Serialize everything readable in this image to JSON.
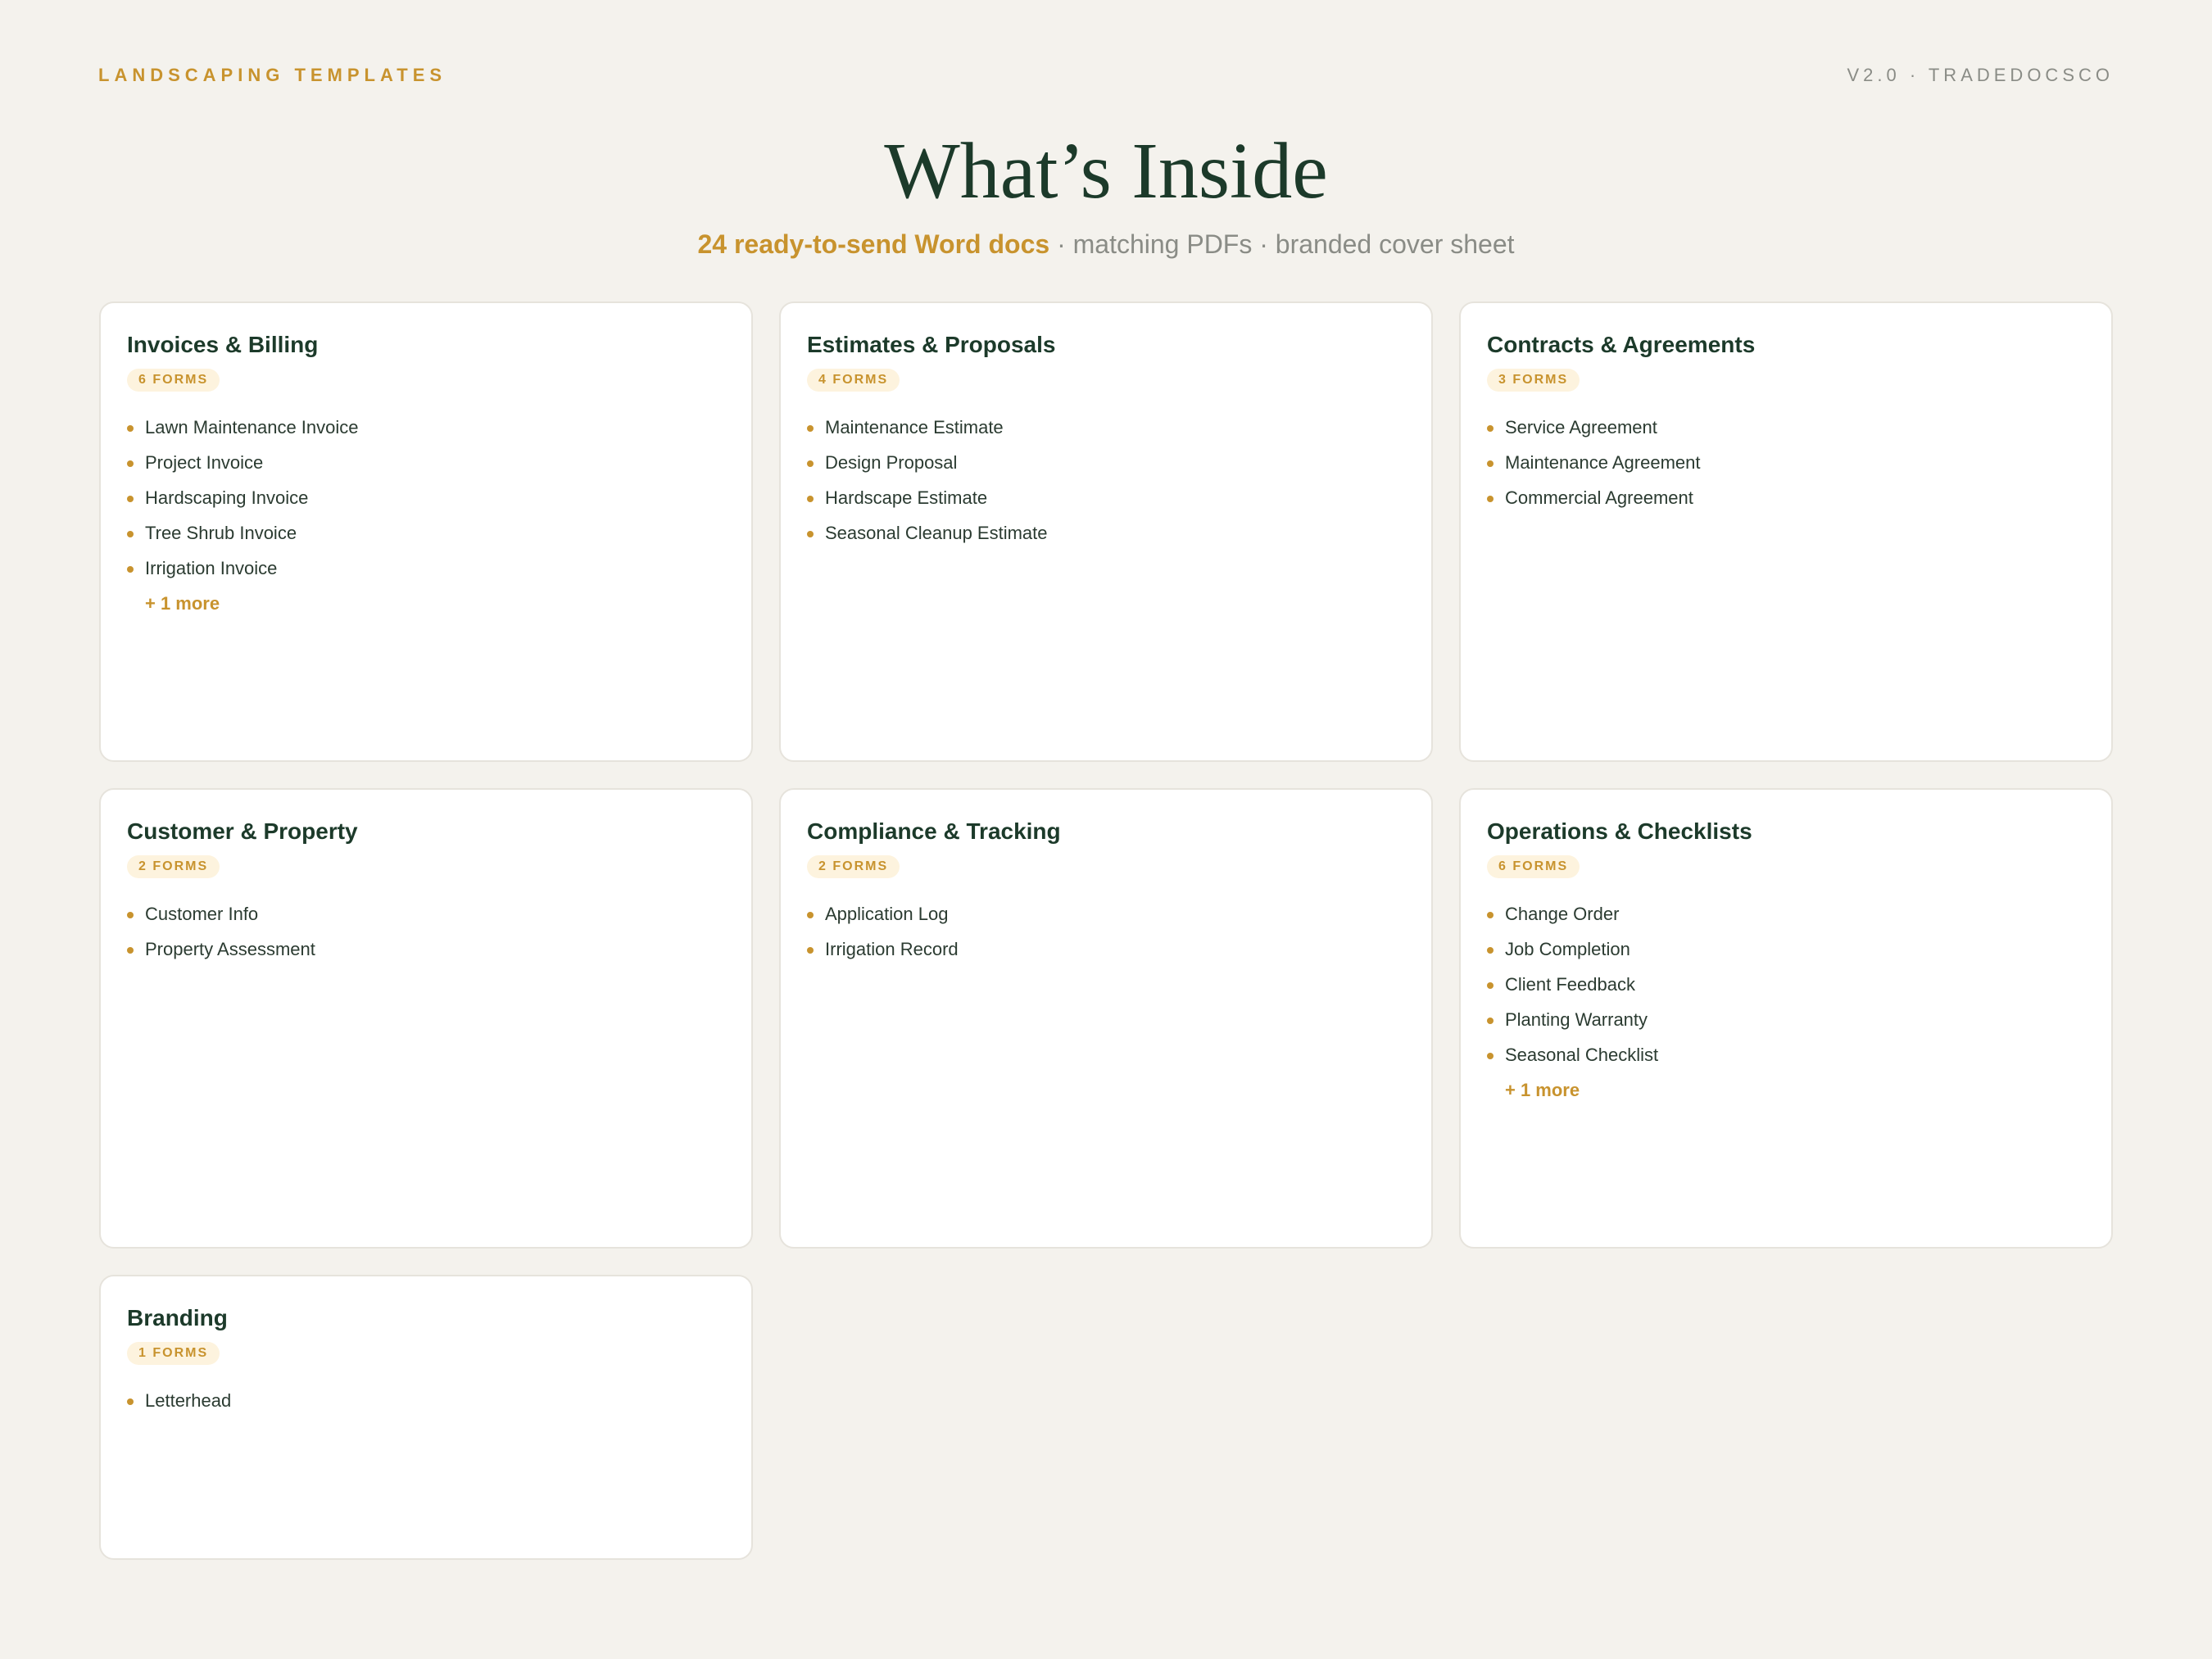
{
  "header": {
    "brand": "LANDSCAPING TEMPLATES",
    "version": "V2.0 · TRADEDOCSCO"
  },
  "hero": {
    "title": "What’s Inside",
    "subtitle_highlight": "24 ready-to-send Word docs",
    "subtitle_rest": " · matching PDFs · branded cover sheet"
  },
  "categories": [
    {
      "title": "Invoices & Billing",
      "badge": "6 FORMS",
      "items": [
        "Lawn Maintenance Invoice",
        "Project Invoice",
        "Hardscaping Invoice",
        "Tree Shrub Invoice",
        "Irrigation Invoice"
      ],
      "more": "+ 1 more"
    },
    {
      "title": "Estimates & Proposals",
      "badge": "4 FORMS",
      "items": [
        "Maintenance Estimate",
        "Design Proposal",
        "Hardscape Estimate",
        "Seasonal Cleanup Estimate"
      ]
    },
    {
      "title": "Contracts & Agreements",
      "badge": "3 FORMS",
      "items": [
        "Service Agreement",
        "Maintenance Agreement",
        "Commercial Agreement"
      ]
    },
    {
      "title": "Customer & Property",
      "badge": "2 FORMS",
      "items": [
        "Customer Info",
        "Property Assessment"
      ]
    },
    {
      "title": "Compliance & Tracking",
      "badge": "2 FORMS",
      "items": [
        "Application Log",
        "Irrigation Record"
      ]
    },
    {
      "title": "Operations & Checklists",
      "badge": "6 FORMS",
      "items": [
        "Change Order",
        "Job Completion",
        "Client Feedback",
        "Planting Warranty",
        "Seasonal Checklist"
      ],
      "more": "+ 1 more"
    },
    {
      "title": "Branding",
      "badge": "1 FORMS",
      "items": [
        "Letterhead"
      ]
    }
  ],
  "colors": {
    "background": "#f4f2ed",
    "accent": "#c8932e",
    "heading": "#1c3a2a",
    "muted": "#8a8c86",
    "card": "#ffffff"
  }
}
